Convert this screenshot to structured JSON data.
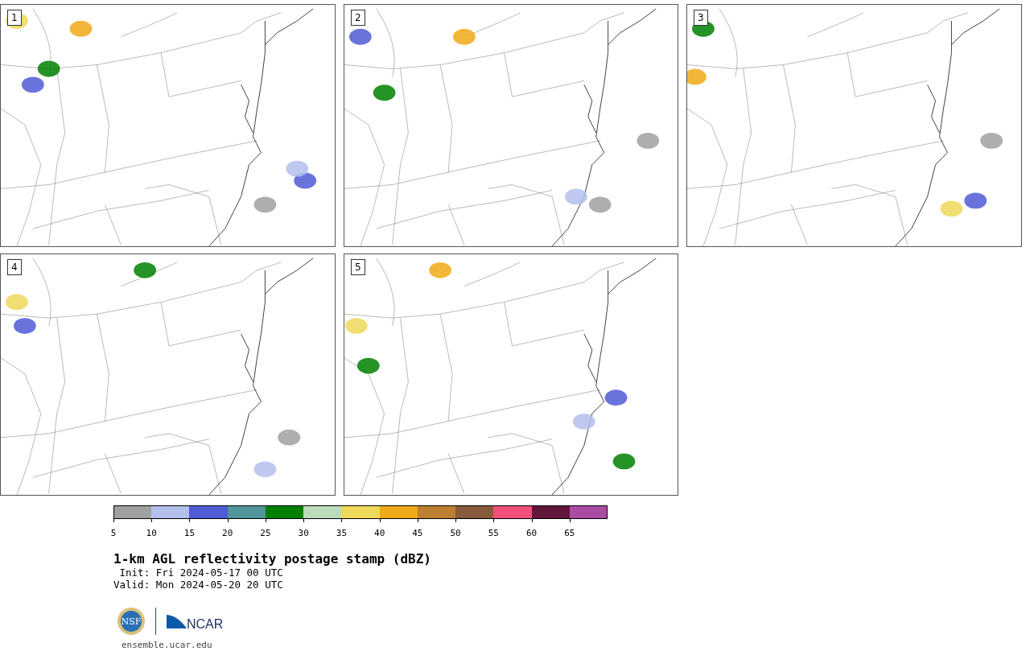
{
  "panels": [
    {
      "number": "1"
    },
    {
      "number": "2"
    },
    {
      "number": "3"
    },
    {
      "number": "4"
    },
    {
      "number": "5"
    }
  ],
  "colorbar": {
    "segments": [
      {
        "color": "#a0a0a0"
      },
      {
        "color": "#b4bfec"
      },
      {
        "color": "#505bd6"
      },
      {
        "color": "#4e9699"
      },
      {
        "color": "#008000"
      },
      {
        "color": "#bcdcbc"
      },
      {
        "color": "#eed85a"
      },
      {
        "color": "#f0aa18"
      },
      {
        "color": "#bc8030"
      },
      {
        "color": "#8a5a3c"
      },
      {
        "color": "#f44f7a"
      },
      {
        "color": "#62163a"
      },
      {
        "color": "#ab4ca4"
      }
    ],
    "tick_labels": [
      "5",
      "10",
      "15",
      "20",
      "25",
      "30",
      "35",
      "40",
      "45",
      "50",
      "55",
      "60",
      "65"
    ]
  },
  "title": "1-km AGL reflectivity postage stamp (dBZ)",
  "init": " Init: Fri 2024-05-17 00 UTC",
  "valid": "Valid: Mon 2024-05-20 20 UTC",
  "logo": {
    "nsf": "NSF",
    "ncar": "NCAR"
  },
  "url": "ensemble.ucar.edu"
}
